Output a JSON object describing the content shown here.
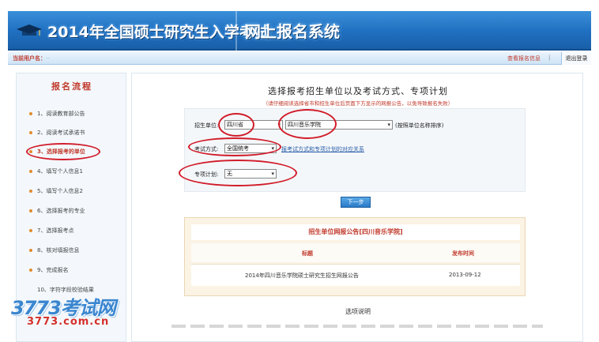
{
  "header": {
    "title": "2014年全国硕士研究生入学考试",
    "system": "网上报名系统"
  },
  "userbar": {
    "current_user_label": "当前用户名：",
    "current_user_value": "··",
    "right_link": "查看报名信息",
    "separator": "|",
    "logout": "退出登录"
  },
  "sidebar": {
    "heading": "报名流程",
    "steps": [
      "1、阅读教育部公告",
      "2、阅读考试承诺书",
      "3、选择报考的单位",
      "4、填写个人信息1",
      "5、填写个人信息2",
      "6、选择报考的专业",
      "7、选择报考点",
      "8、核对填报信息",
      "9、完成报名",
      "10、字符字段校验结果"
    ]
  },
  "main": {
    "title": "选择报考招生单位以及考试方式、专项计划",
    "hint": "（请仔细阅读选择省市和招生单位后页面下方显示的网报公告，以免导致报名失败）",
    "unit_label": "招生单位:",
    "province_value": "四川省",
    "school_value": "四川音乐学院",
    "search_hint": "(按照单位名称排序)",
    "exam_label": "考试方式:",
    "exam_value": "全国统考",
    "exam_link": "报考试方式和专项计划的对应关系",
    "plan_label": "专项计划:",
    "plan_value": "无",
    "next_button": "下一步",
    "notice": {
      "heading": "招生单位网报公告[四川音乐学院]",
      "col_title": "标题",
      "col_time": "发布时间",
      "row_title": "2014年四川音乐学院硕士研究生招生网报公告",
      "row_time": "2013-09-12"
    },
    "explain": "选项说明"
  },
  "watermark": {
    "brand": "3773考试网",
    "url": "3773.com.cn"
  },
  "colors": {
    "banner_blue": "#1f6fc0",
    "accent_red": "#c0392b",
    "ring_red": "#d11c2a"
  }
}
